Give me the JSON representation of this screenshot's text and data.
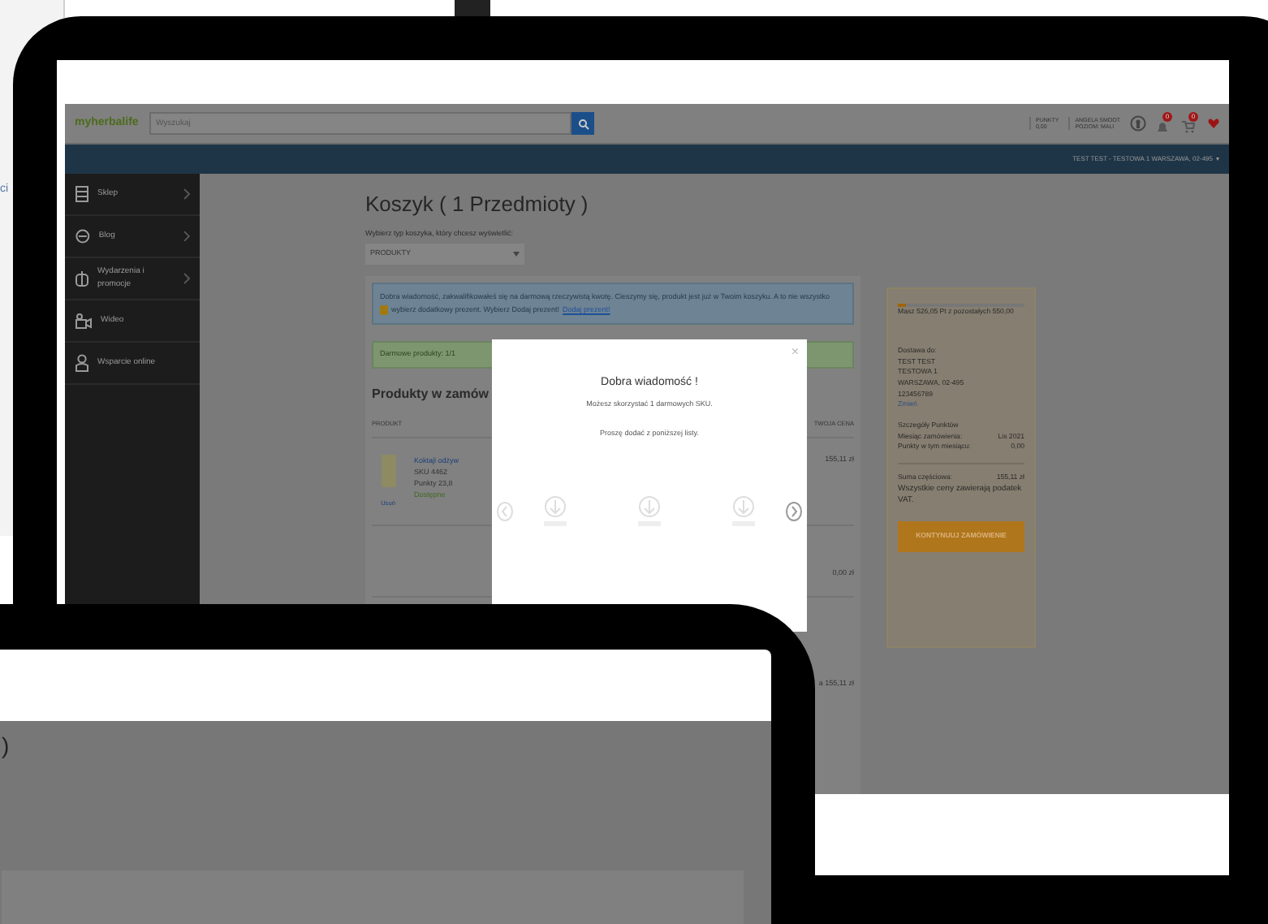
{
  "back_screen": {
    "fragment": "ci"
  },
  "header": {
    "logo": "myherbalife",
    "search_placeholder": "Wyszukaj",
    "points_label": "PUNKTY",
    "points_value": "0,00",
    "user_name": "ANGELA SMOOT",
    "user_level": "POZIOM: MALI",
    "notification_count": "0",
    "cart_count": "0"
  },
  "address_bar": {
    "text": "TEST TEST - TESTOWA 1 WARSZAWA, 02-495",
    "caret": "▾"
  },
  "sidebar": {
    "items": [
      {
        "label": "Sklep",
        "kind": "store",
        "has_submenu": true
      },
      {
        "label": "Blog",
        "kind": "blog",
        "has_submenu": true
      },
      {
        "label": "Wydarzenia i promocje",
        "kind": "events",
        "has_submenu": true
      },
      {
        "label": "Wideo",
        "kind": "video",
        "has_submenu": false
      },
      {
        "label": "Wsparcie online",
        "kind": "support",
        "has_submenu": false
      }
    ]
  },
  "cart": {
    "title": "Koszyk ( 1 Przedmioty )",
    "type_label": "Wybierz typ koszyka, który chcesz wyświetlić:",
    "type_value": "PRODUKTY",
    "info_text": "Dobra wiadomość, zakwalifikowałeś się na darmową rzeczywistą kwotę. Cieszymy się, produkt jest już w Twoim koszyku. A to nie wszystko",
    "info_text_2": "wybierz dodatkowy prezent. Wybierz Dodaj prezent!",
    "info_link": "Dodaj prezent!",
    "free_text": "Darmowe produkty: 1/1",
    "products_heading": "Produkty w zamów",
    "columns": [
      "PRODUKT",
      "TWOJA CENA"
    ],
    "product": {
      "name": "Koktajl odżyw",
      "sku": "SKU 4462",
      "points": "Punkty 23,8",
      "availability": "Dostępne",
      "remove": "Usuń",
      "price": "155,11 zł"
    },
    "free_price": "0,00 zł",
    "total": "a 155,11 zł"
  },
  "modal": {
    "close": "×",
    "title": "Dobra wiadomość !",
    "subtitle": "Możesz skorzystać 1 darmowych SKU.",
    "instruction": "Proszę dodać z poniższej listy."
  },
  "summary": {
    "progress": {
      "level": 0.06,
      "text": "Masz 526,05 Pt z pozostałych 550,00"
    },
    "delivery_label": "Dostawa do:",
    "address_lines": [
      "TEST TEST",
      "TESTOWA 1",
      "WARSZAWA, 02-495",
      "123456789"
    ],
    "change": "Zmień",
    "points_heading": "Szczegóły Punktów",
    "rows": [
      {
        "label": "Miesiąc zamówienia:",
        "value": "Lis 2021"
      },
      {
        "label": "Punkty w tym miesiącu:",
        "value": "0,00"
      }
    ],
    "subtotal_label": "Suma częściowa:",
    "subtotal_value": "155,11 zł",
    "vat_note": "Wszystkie ceny zawierają podatek VAT.",
    "button": "KONTYNUUJ ZAMÓWIENIE"
  },
  "front_screen": {
    "fragment": ")"
  }
}
